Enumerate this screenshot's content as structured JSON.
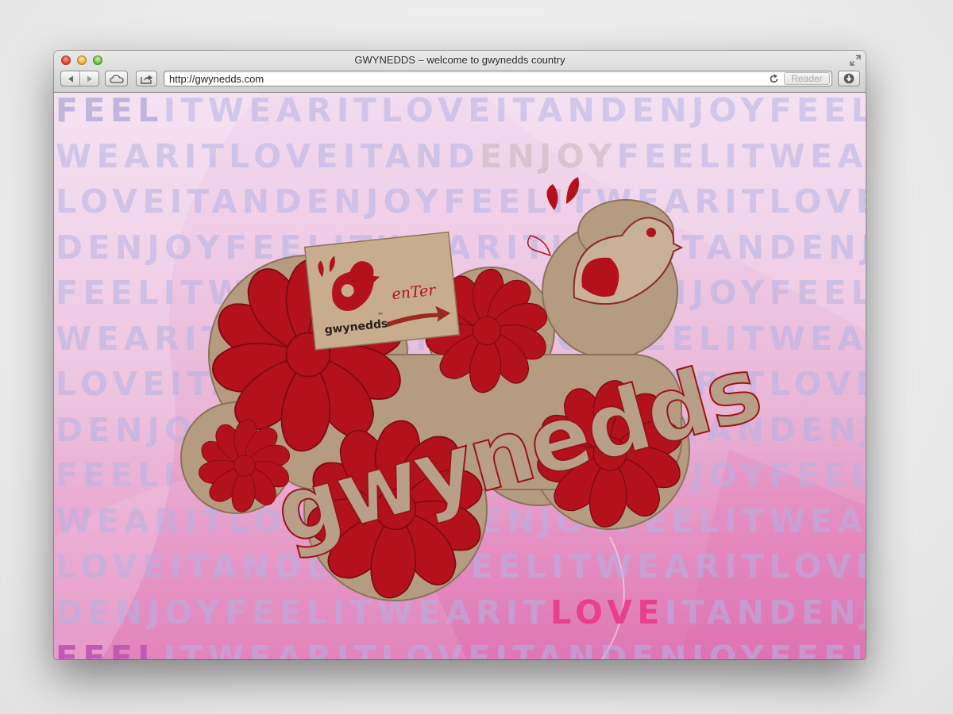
{
  "window": {
    "title": "GWYNEDDS – welcome to gwynedds country"
  },
  "toolbar": {
    "url": "http://gwynedds.com",
    "reader_label": "Reader"
  },
  "page": {
    "background_words": [
      {
        "segments": [
          {
            "text": "FEEL",
            "style": "hl-1"
          },
          {
            "text": "ITWEARITLOVEITANDENJOYFEELIT"
          }
        ]
      },
      {
        "segments": [
          {
            "text": "WEARITLOVEITAND"
          },
          {
            "text": "ENJOY",
            "style": "hl-2"
          },
          {
            "text": "FEELITWEARIT"
          }
        ]
      },
      {
        "segments": [
          {
            "text": "LOVEITANDENJOYFEELITWEARITLOVEITAN"
          }
        ]
      },
      {
        "segments": [
          {
            "text": "DENJOYFEELITWEARITLOVEITANDENJOY"
          }
        ]
      },
      {
        "segments": [
          {
            "text": "FEELITWEARITLOVEITANDENJOYFEELIT"
          }
        ]
      },
      {
        "segments": [
          {
            "text": "WEARITLOVEITANDENJOYFEELITWEARIT"
          }
        ]
      },
      {
        "segments": [
          {
            "text": "LOVEITANDENJOYFEELITWEARITLOVEITAN"
          }
        ]
      },
      {
        "segments": [
          {
            "text": "DENJOYFEELITWEARITLOVEITANDENJOY"
          }
        ]
      },
      {
        "segments": [
          {
            "text": "FEELITWEARITLOVEITANDENJOYFEELIT"
          }
        ]
      },
      {
        "segments": [
          {
            "text": "WEARITLOVEITANDENJOYFEELITWEARIT"
          }
        ]
      },
      {
        "segments": [
          {
            "text": "LOVEITANDENJOYFEELITWEARITLOVEITAN"
          }
        ]
      },
      {
        "segments": [
          {
            "text": "DENJOYFEELITWEARIT"
          },
          {
            "text": "LOVE",
            "style": "hl-3"
          },
          {
            "text": "ITANDENJOY"
          }
        ]
      },
      {
        "segments": [
          {
            "text": "FEEL",
            "style": "hl-4"
          },
          {
            "text": "ITWEARITLOVEITANDENJOYFEELIT"
          }
        ]
      }
    ],
    "logo_text": "gwynedds",
    "enter_card": {
      "brand": "gwynedds",
      "trademark": "™",
      "enter_label": "enTer"
    }
  },
  "colors": {
    "logo_red": "#b0121c",
    "cardboard": "#b49a80",
    "pink_highlight": "#ea3f8d"
  }
}
